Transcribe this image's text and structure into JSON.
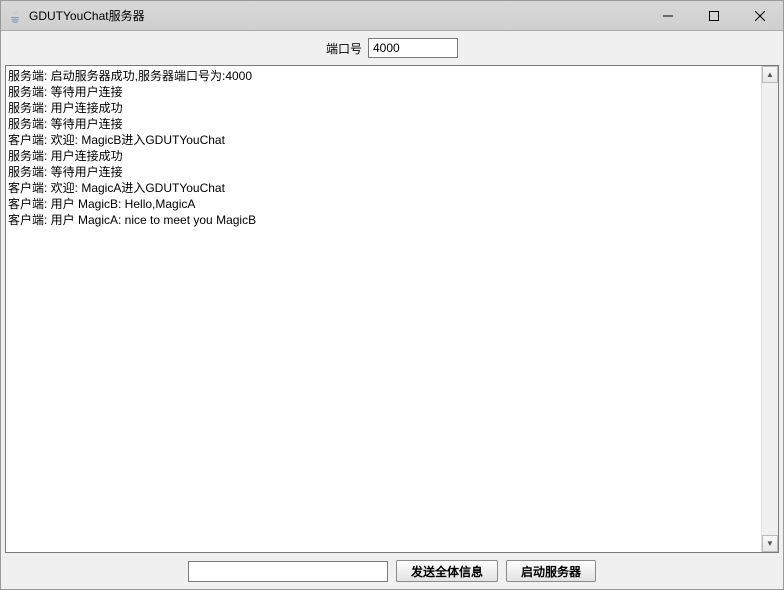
{
  "window": {
    "title": "GDUTYouChat服务器"
  },
  "port": {
    "label": "端口号",
    "value": "4000"
  },
  "log": {
    "lines": [
      "服务端: 启动服务器成功,服务器端口号为:4000",
      "服务端: 等待用户连接",
      "服务端: 用户连接成功",
      "服务端: 等待用户连接",
      "客户端: 欢迎: MagicB进入GDUTYouChat",
      "服务端: 用户连接成功",
      "服务端: 等待用户连接",
      "客户端: 欢迎: MagicA进入GDUTYouChat",
      "客户端: 用户 MagicB: Hello,MagicA",
      "客户端: 用户 MagicA: nice to meet you MagicB"
    ]
  },
  "bottom": {
    "message_value": "",
    "send_all_label": "发送全体信息",
    "start_server_label": "启动服务器"
  }
}
